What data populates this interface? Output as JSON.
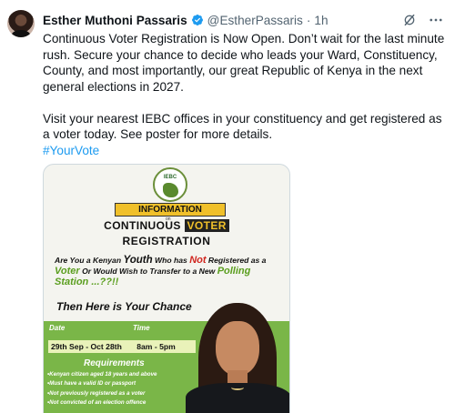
{
  "tweet": {
    "author_name": "Esther Muthoni Passaris",
    "handle": "@EstherPassaris",
    "separator": "·",
    "time": "1h",
    "body_line1": "Continuous Voter Registration is Now Open. Don’t wait for the last minute rush. Secure your chance to decide who leads your Ward, Constituency, County, and most importantly, our great Republic of Kenya in the next general elections in 2027.",
    "body_line2": "Visit your nearest IEBC offices in your constituency and get registered as a voter today. See poster for more details.",
    "hashtag": "#YourVote"
  },
  "poster": {
    "logo_text": "IEBC",
    "info_label": "INFORMATION",
    "info_of": "on",
    "continuous": "CONTINUOUS",
    "voter": "VOTER",
    "registration": "REGISTRATION",
    "q_part1": "Are You a Kenyan ",
    "q_youth": "Youth",
    "q_part2": " Who has ",
    "q_not": "Not",
    "q_part3": " Registered as a ",
    "q_voter": "Voter",
    "q_part4": " Or Would Wish to Transfer to a New ",
    "q_station": "Polling Station ...??!!",
    "chance": "Then Here is Your Chance",
    "date_header": "Date",
    "time_header": "Time",
    "date_range": "29th Sep - Oct 28th",
    "time_range": "8am - 5pm",
    "requirements_title": "Requirements",
    "requirements": [
      "Kenyan citizen aged 18 years and above",
      "Must have a valid ID or passport",
      "Not previously registered as a voter",
      "Not convicted of an election offence"
    ]
  },
  "colors": {
    "link": "#1d9bf0",
    "verified": "#1d9bf0",
    "poster_green": "#7ab648",
    "poster_yellow": "#f0c02a",
    "poster_red": "#d0251e"
  },
  "icons": {
    "verified": "verified-badge-icon",
    "grok": "grok-icon",
    "more": "more-options-icon"
  }
}
